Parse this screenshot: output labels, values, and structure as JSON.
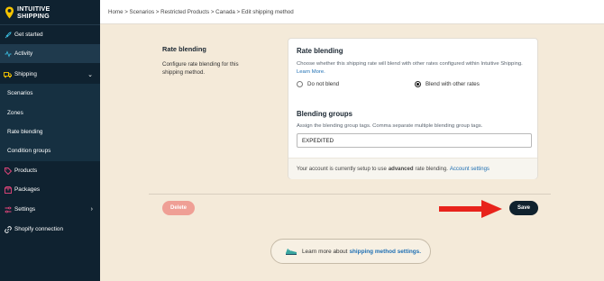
{
  "brand": {
    "line1": "INTUITIVE",
    "line2": "SHIPPING"
  },
  "sidebar": {
    "items": [
      {
        "label": "Get started"
      },
      {
        "label": "Activity"
      },
      {
        "label": "Shipping"
      },
      {
        "label": "Scenarios"
      },
      {
        "label": "Zones"
      },
      {
        "label": "Rate blending"
      },
      {
        "label": "Condition groups"
      },
      {
        "label": "Products"
      },
      {
        "label": "Packages"
      },
      {
        "label": "Settings"
      },
      {
        "label": "Shopify connection"
      }
    ]
  },
  "breadcrumb": "Home > Scenarios > Restricted Products > Canada > Edit shipping method",
  "section": {
    "title": "Rate blending",
    "description": "Configure rate blending for this shipping method."
  },
  "card": {
    "title": "Rate blending",
    "description": "Choose whether this shipping rate will blend with other rates configured within Intuitive Shipping.",
    "learn_more": "Learn More.",
    "options": [
      "Do not blend",
      "Blend with other rates"
    ],
    "selected_option": "Blend with other rates",
    "groups_title": "Blending groups",
    "groups_description": "Assign the blending group tags. Comma separate multiple blending group tags.",
    "groups_value": "EXPEDITED",
    "footer_prefix": "Your account is currently setup to use",
    "footer_bold": "advanced",
    "footer_middle": "rate blending.",
    "footer_link": "Account settings"
  },
  "actions": {
    "delete": "Delete",
    "save": "Save"
  },
  "learn_box": {
    "prefix": "Learn more about",
    "link": "shipping method settings."
  },
  "colors": {
    "sidebar": "#0f2230",
    "page": "#f4ead9",
    "save": "#10222e",
    "delete": "#ef9f95",
    "arrow": "#e8231b",
    "link": "#1e6fb3"
  }
}
